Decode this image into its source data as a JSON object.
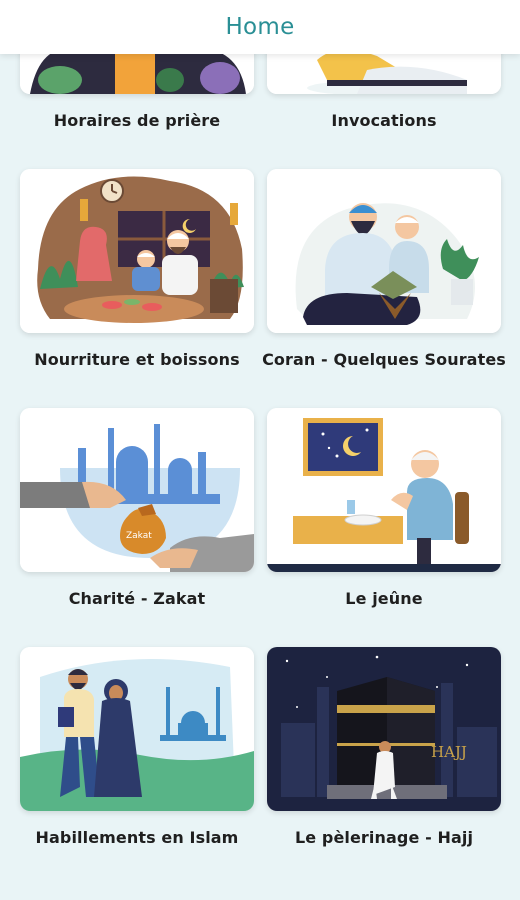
{
  "header": {
    "title": "Home"
  },
  "items": [
    {
      "label": "Horaires de prière",
      "icon": "prayer-times-illustration"
    },
    {
      "label": "Invocations",
      "icon": "invocations-illustration"
    },
    {
      "label": "Nourriture et boissons",
      "icon": "family-meal-illustration"
    },
    {
      "label": "Coran - Quelques Sourates",
      "icon": "quran-reading-illustration"
    },
    {
      "label": "Charité - Zakat",
      "icon": "zakat-charity-illustration"
    },
    {
      "label": "Le jeûne",
      "icon": "fasting-illustration"
    },
    {
      "label": "Habillements en Islam",
      "icon": "islamic-clothing-illustration"
    },
    {
      "label": "Le pèlerinage - Hajj",
      "icon": "kaaba-hajj-illustration"
    }
  ],
  "hajj_image_text": "HAJJ",
  "zakat_bag_text": "Zakat",
  "colors": {
    "header_text": "#2a8f95",
    "background": "#e9f4f6",
    "card": "#ffffff"
  }
}
